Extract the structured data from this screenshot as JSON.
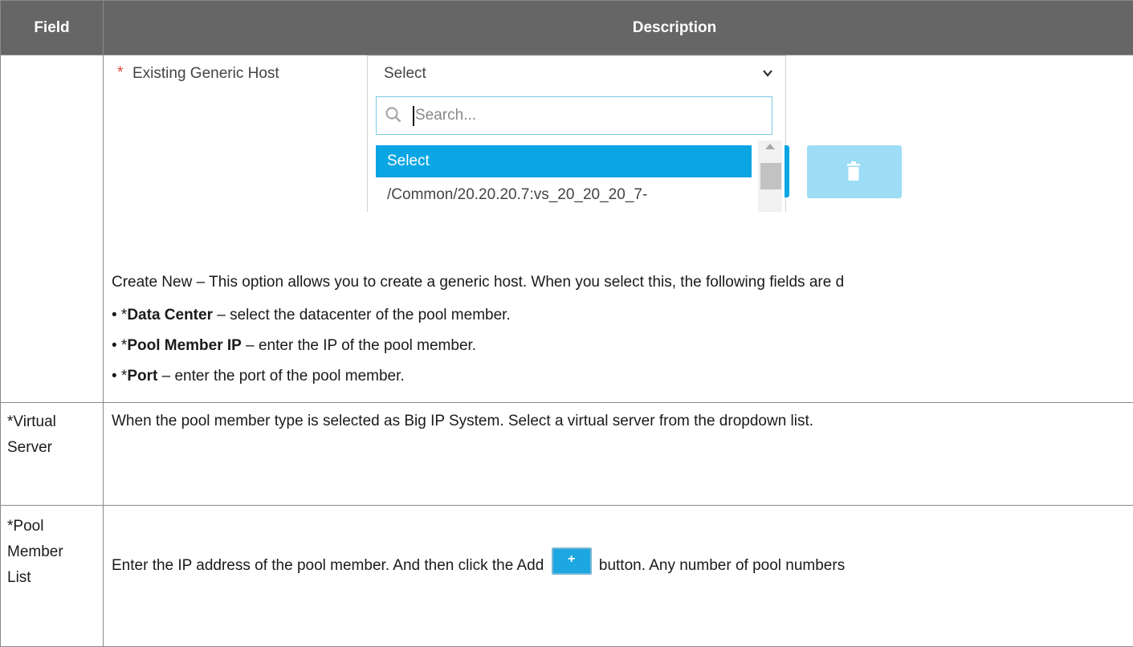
{
  "header": {
    "field": "Field",
    "description": "Description"
  },
  "row1": {
    "embed": {
      "required_marker": "*",
      "label": "Existing Generic Host",
      "select_value": "Select",
      "search_placeholder": "Search...",
      "options": [
        "Select",
        "/Common/20.20.20.7:vs_20_20_20_7-"
      ]
    },
    "create_new": "Create New – This option allows you to create a generic host. When you select this, the following fields are d",
    "bullets": [
      {
        "prefix": "• *",
        "bold": "Data Center",
        "text": " – select the datacenter of the pool member."
      },
      {
        "prefix": "• *",
        "bold": "Pool Member IP",
        "text": " – enter the IP of the pool member."
      },
      {
        "prefix": "• *",
        "bold": "Port",
        "text": " – enter the port of the pool member."
      }
    ]
  },
  "row2": {
    "field_line1": "*Virtual",
    "field_line2": "Server",
    "description": "When the pool member type is selected as Big IP System. Select a virtual server from the dropdown list."
  },
  "row3": {
    "field_line1": "*Pool",
    "field_line2": "Member",
    "field_line3": "List",
    "desc_before": "Enter the IP address of the pool member. And then click the Add",
    "add_symbol": "+",
    "desc_after": "button. Any number of pool numbers"
  }
}
